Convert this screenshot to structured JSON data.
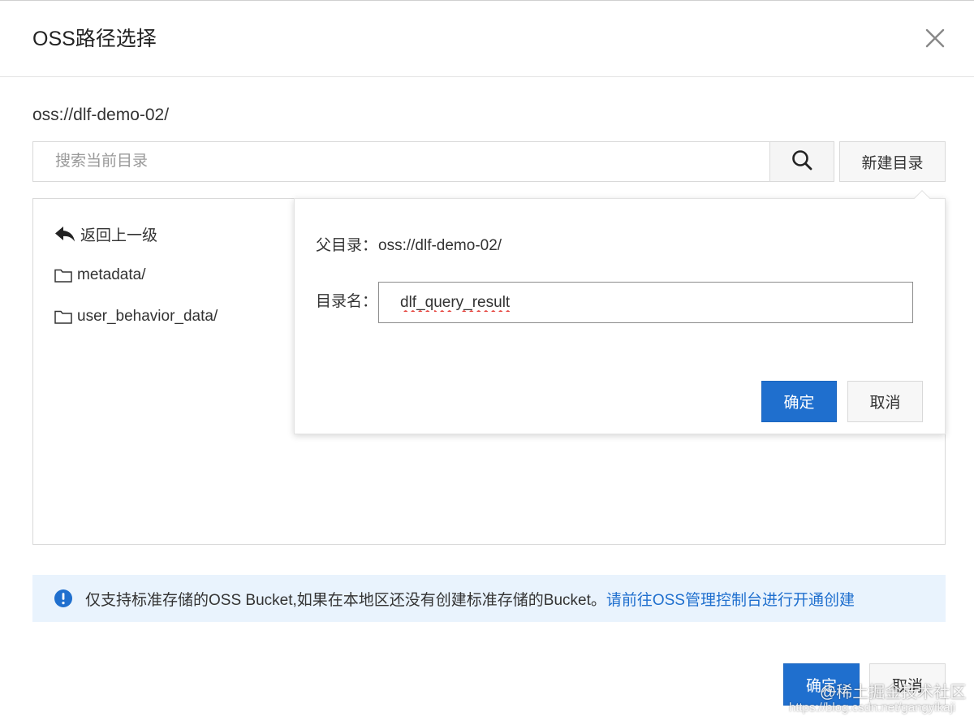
{
  "dialog": {
    "title": "OSS路径选择",
    "current_path": "oss://dlf-demo-02/"
  },
  "search": {
    "placeholder": "搜索当前目录"
  },
  "toolbar": {
    "new_dir_label": "新建目录"
  },
  "file_list": {
    "back_label": "返回上一级",
    "items": [
      {
        "name": "metadata/"
      },
      {
        "name": "user_behavior_data/"
      }
    ]
  },
  "new_dir_popover": {
    "parent_label": "父目录：",
    "parent_value": "oss://dlf-demo-02/",
    "name_label": "目录名：",
    "name_value": "dlf_query_result",
    "confirm_label": "确定",
    "cancel_label": "取消"
  },
  "notice": {
    "text": "仅支持标准存储的OSS Bucket,如果在本地区还没有创建标准存储的Bucket。",
    "link_text": "请前往OSS管理控制台进行开通创建"
  },
  "footer": {
    "confirm_label": "确定",
    "cancel_label": "取消"
  },
  "watermark": {
    "line1": "@稀土掘金技术社区",
    "line2": "https://blog.csdn.net/gangyikaji"
  },
  "colors": {
    "primary": "#1f6fce",
    "notice_bg": "#e9f3fd"
  },
  "icons": {
    "close": "close-icon",
    "search": "search-icon",
    "back": "reply-arrow-icon",
    "folder": "folder-icon",
    "info": "info-icon"
  }
}
